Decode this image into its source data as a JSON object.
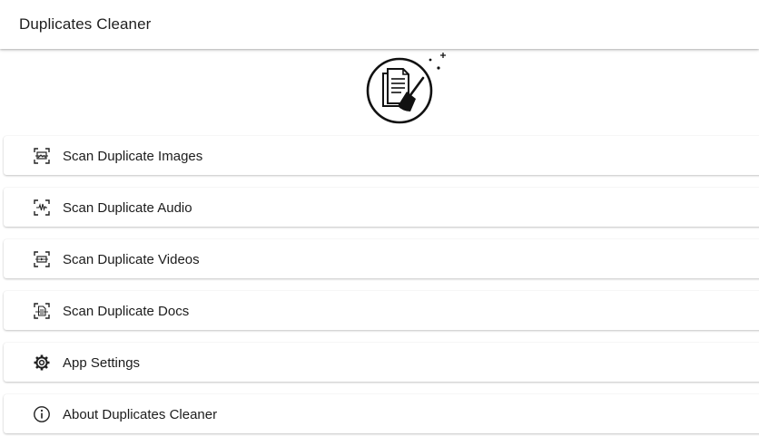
{
  "app_bar": {
    "title": "Duplicates Cleaner"
  },
  "header_logo": {
    "icon": "document-broom-icon"
  },
  "menu": {
    "items": [
      {
        "label": "Scan Duplicate Images",
        "icon": "scan-image-icon"
      },
      {
        "label": "Scan Duplicate Audio",
        "icon": "scan-audio-icon"
      },
      {
        "label": "Scan Duplicate Videos",
        "icon": "scan-video-icon"
      },
      {
        "label": "Scan Duplicate Docs",
        "icon": "scan-document-icon"
      },
      {
        "label": "App Settings",
        "icon": "gear-icon"
      },
      {
        "label": "About Duplicates Cleaner",
        "icon": "info-icon"
      }
    ]
  },
  "colors": {
    "background": "#ffffff",
    "text": "#1c1c1c",
    "icon": "#222222"
  }
}
